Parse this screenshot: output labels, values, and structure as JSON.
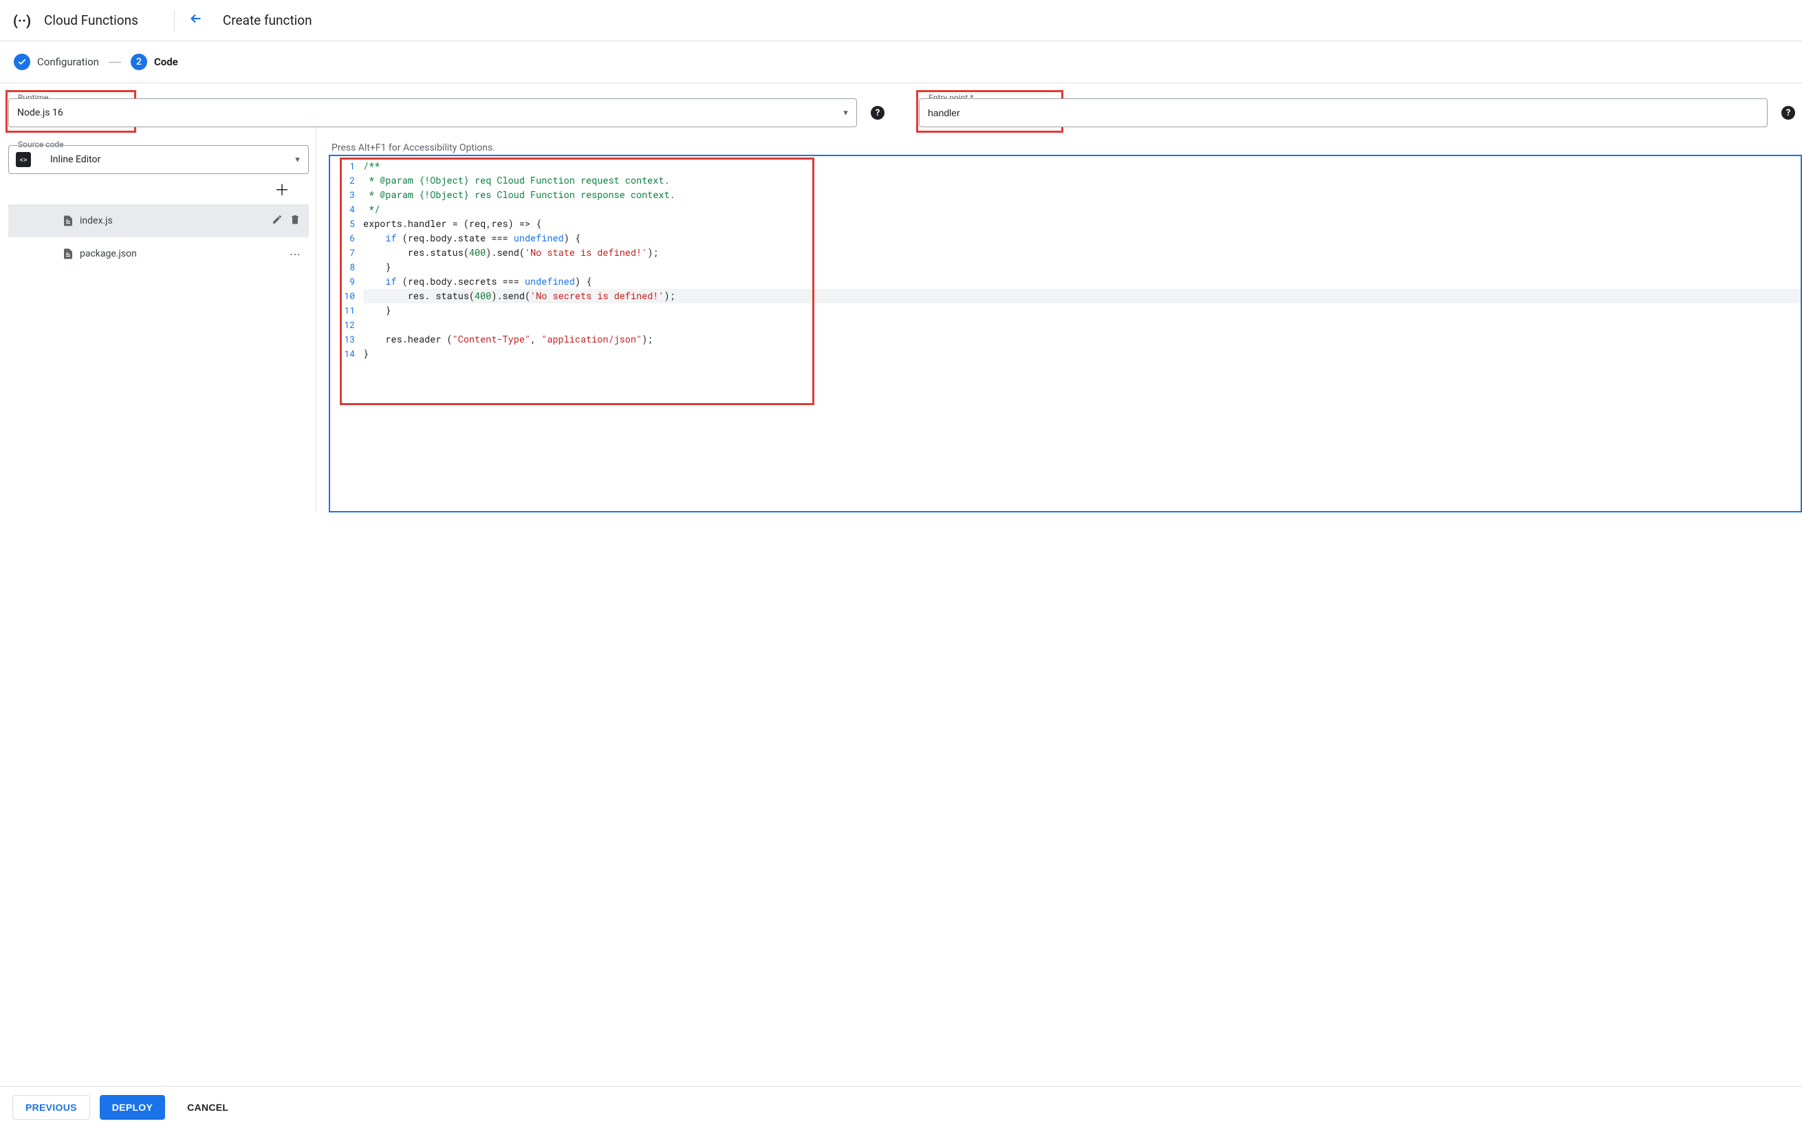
{
  "header": {
    "service_name": "Cloud Functions",
    "page_title": "Create function"
  },
  "stepper": {
    "step1": {
      "label": "Configuration"
    },
    "step2": {
      "number": "2",
      "label": "Code"
    }
  },
  "runtime": {
    "legend": "Runtime",
    "value": "Node.js 16"
  },
  "entry_point": {
    "legend": "Entry point *",
    "value": "handler"
  },
  "source_code": {
    "legend": "Source code",
    "value": "Inline Editor"
  },
  "files": [
    {
      "name": "index.js",
      "selected": true
    },
    {
      "name": "package.json",
      "selected": false
    }
  ],
  "editor": {
    "accessibility_hint": "Press Alt+F1 for Accessibility Options.",
    "lines": [
      {
        "n": 1,
        "tokens": [
          {
            "t": "/**",
            "c": "comment"
          }
        ]
      },
      {
        "n": 2,
        "tokens": [
          {
            "t": " * @param {!Object} req Cloud Function request context.",
            "c": "comment"
          }
        ]
      },
      {
        "n": 3,
        "tokens": [
          {
            "t": " * @param {!Object} res Cloud Function response context.",
            "c": "comment"
          }
        ]
      },
      {
        "n": 4,
        "tokens": [
          {
            "t": " */",
            "c": "comment"
          }
        ]
      },
      {
        "n": 5,
        "tokens": [
          {
            "t": "exports.handler = (req,res) => {",
            "c": "plain"
          }
        ]
      },
      {
        "n": 6,
        "tokens": [
          {
            "t": "    ",
            "c": "plain"
          },
          {
            "t": "if",
            "c": "kw"
          },
          {
            "t": " (req.body.state === ",
            "c": "plain"
          },
          {
            "t": "undefined",
            "c": "undef"
          },
          {
            "t": ") {",
            "c": "plain"
          }
        ]
      },
      {
        "n": 7,
        "tokens": [
          {
            "t": "        res.status(",
            "c": "plain"
          },
          {
            "t": "400",
            "c": "num"
          },
          {
            "t": ").send(",
            "c": "plain"
          },
          {
            "t": "'No state is defined!'",
            "c": "str"
          },
          {
            "t": ");",
            "c": "plain"
          }
        ]
      },
      {
        "n": 8,
        "tokens": [
          {
            "t": "    }",
            "c": "plain"
          }
        ]
      },
      {
        "n": 9,
        "tokens": [
          {
            "t": "    ",
            "c": "plain"
          },
          {
            "t": "if",
            "c": "kw"
          },
          {
            "t": " (req.body.secrets === ",
            "c": "plain"
          },
          {
            "t": "undefined",
            "c": "undef"
          },
          {
            "t": ") {",
            "c": "plain"
          }
        ]
      },
      {
        "n": 10,
        "hl": true,
        "tokens": [
          {
            "t": "        res. status(",
            "c": "plain"
          },
          {
            "t": "400",
            "c": "num"
          },
          {
            "t": ").send(",
            "c": "plain"
          },
          {
            "t": "'No secrets is defined!'",
            "c": "str"
          },
          {
            "t": ");",
            "c": "plain"
          }
        ]
      },
      {
        "n": 11,
        "tokens": [
          {
            "t": "    }",
            "c": "plain"
          }
        ]
      },
      {
        "n": 12,
        "tokens": [
          {
            "t": "",
            "c": "plain"
          }
        ]
      },
      {
        "n": 13,
        "tokens": [
          {
            "t": "    res.header (",
            "c": "plain"
          },
          {
            "t": "\"Content-Type\"",
            "c": "str"
          },
          {
            "t": ", ",
            "c": "plain"
          },
          {
            "t": "\"application/json\"",
            "c": "str"
          },
          {
            "t": ");",
            "c": "plain"
          }
        ]
      },
      {
        "n": 14,
        "tokens": [
          {
            "t": "}",
            "c": "plain"
          }
        ]
      }
    ]
  },
  "footer": {
    "previous": "PREVIOUS",
    "deploy": "DEPLOY",
    "cancel": "CANCEL"
  }
}
